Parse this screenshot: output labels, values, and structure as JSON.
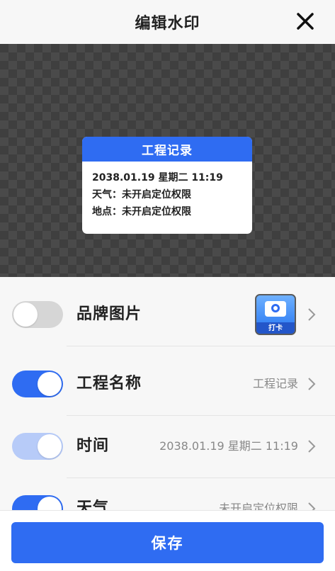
{
  "header": {
    "title": "编辑水印",
    "close_icon": "close-icon"
  },
  "watermark": {
    "title": "工程记录",
    "lines": [
      "2038.01.19 星期二 11:19",
      "天气：未开启定位权限",
      "地点：未开启定位权限"
    ]
  },
  "settings": [
    {
      "label": "品牌图片",
      "enabled": false,
      "brand_caption": "打卡"
    },
    {
      "label": "工程名称",
      "enabled": true,
      "value": "工程记录"
    },
    {
      "label": "时间",
      "enabled": true,
      "disabled_style": true,
      "value": "2038.01.19 星期二 11:19"
    },
    {
      "label": "天气",
      "enabled": true,
      "value": "未开启定位权限"
    }
  ],
  "footer": {
    "save_label": "保存"
  },
  "colors": {
    "accent": "#2f6cf2",
    "accent_light": "#b7cbf8",
    "toggle_off": "#d6d6d6"
  }
}
